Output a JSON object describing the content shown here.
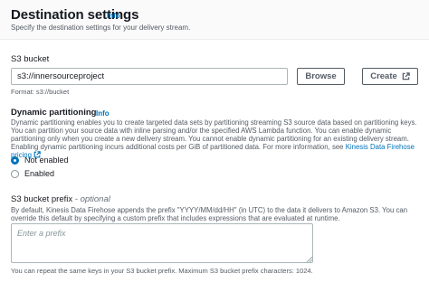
{
  "header": {
    "title": "Destination settings",
    "info": "Info",
    "subtitle": "Specify the destination settings for your delivery stream."
  },
  "s3_bucket": {
    "label": "S3 bucket",
    "value": "s3://innersourceproject",
    "browse_label": "Browse",
    "create_label": "Create",
    "format_hint": "Format: s3://bucket",
    "create_icon": "external-link-icon"
  },
  "dynamic_partitioning": {
    "label": "Dynamic partitioning",
    "info": "Info",
    "description": "Dynamic partitioning enables you to create targeted data sets by partitioning streaming S3 source data based on partitioning keys. You can partition your source data with inline parsing and/or the specified AWS Lambda function. You can enable dynamic partitioning only when you create a new delivery stream. You cannot enable dynamic partitioning for an existing delivery stream. Enabling dynamic partitioning incurs additional costs per GiB of partitioned data. For more information, see ",
    "link_text": "Kinesis Data Firehose pricing",
    "options": [
      {
        "label": "Not enabled",
        "checked": true
      },
      {
        "label": "Enabled",
        "checked": false
      }
    ]
  },
  "prefix": {
    "label": "S3 bucket prefix",
    "label_suffix": " - optional",
    "description": "By default, Kinesis Data Firehose appends the prefix \"YYYY/MM/dd/HH\" (in UTC) to the data it delivers to Amazon S3. You can override this default by specifying a custom prefix that includes expressions that are evaluated at runtime.",
    "placeholder": "Enter a prefix",
    "footer": "You can repeat the same keys in your S3 bucket prefix. Maximum S3 bucket prefix characters: 1024."
  },
  "colors": {
    "accent": "#0073bb",
    "text": "#16191f",
    "muted": "#545b64",
    "border": "#aab7b8"
  }
}
